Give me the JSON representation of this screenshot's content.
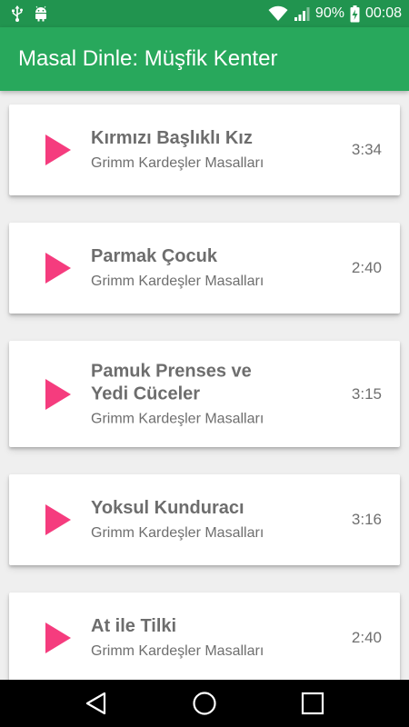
{
  "status_bar": {
    "icons": [
      "usb-icon",
      "android-icon",
      "wifi-icon",
      "signal-icon",
      "battery-charging-icon"
    ],
    "battery": "90%",
    "time": "00:08"
  },
  "app_bar": {
    "title": "Masal Dinle: Müşfik Kenter"
  },
  "tracks": [
    {
      "title": "Kırmızı Başlıklı Kız",
      "subtitle": "Grimm Kardeşler Masalları",
      "duration": "3:34"
    },
    {
      "title": "Parmak Çocuk",
      "subtitle": "Grimm Kardeşler Masalları",
      "duration": "2:40"
    },
    {
      "title": "Pamuk Prenses ve Yedi Cüceler",
      "subtitle": "Grimm Kardeşler Masalları",
      "duration": "3:15"
    },
    {
      "title": "Yoksul Kunduracı",
      "subtitle": "Grimm Kardeşler Masalları",
      "duration": "3:16"
    },
    {
      "title": "At ile Tilki",
      "subtitle": "Grimm Kardeşler Masalları",
      "duration": "2:40"
    }
  ],
  "nav_bar": {
    "icons": [
      "back-icon",
      "home-icon",
      "recents-icon"
    ]
  },
  "colors": {
    "status_bar": "#21944f",
    "app_bar": "#28a85c",
    "play_icon": "#f53c7e",
    "text": "#6d6d6d"
  }
}
